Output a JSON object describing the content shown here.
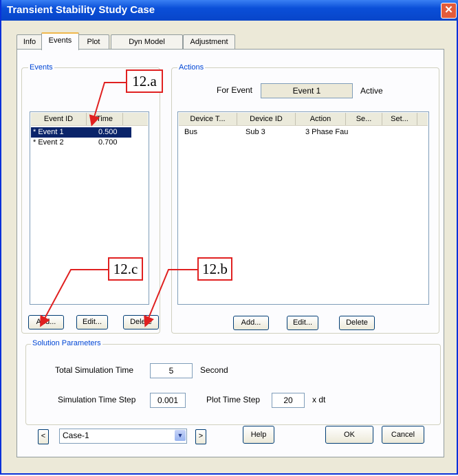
{
  "window": {
    "title": "Transient Stability Study Case",
    "close_glyph": "✕"
  },
  "tabs": [
    "Info",
    "Events",
    "Plot",
    "Dyn Model",
    "Adjustment"
  ],
  "events": {
    "group_label": "Events",
    "columns": [
      "Event ID",
      "Time"
    ],
    "rows": [
      {
        "id": "* Event 1",
        "time": "0.500",
        "selected": true
      },
      {
        "id": "* Event 2",
        "time": "0.700",
        "selected": false
      }
    ],
    "buttons": {
      "add": "Add...",
      "edit": "Edit...",
      "delete": "Delete"
    }
  },
  "actions": {
    "group_label": "Actions",
    "for_event_label": "For Event",
    "for_event_value": "Event 1",
    "status": "Active",
    "columns": [
      "Device T...",
      "Device ID",
      "Action",
      "Se...",
      "Set..."
    ],
    "rows": [
      {
        "device_type": "Bus",
        "device_id": "Sub 3",
        "action": "3 Phase Fau"
      }
    ],
    "buttons": {
      "add": "Add...",
      "edit": "Edit...",
      "delete": "Delete"
    }
  },
  "solution": {
    "group_label": "Solution Parameters",
    "total_sim_time_label": "Total Simulation Time",
    "total_sim_time_value": "5",
    "total_sim_time_unit": "Second",
    "sim_time_step_label": "Simulation Time Step",
    "sim_time_step_value": "0.001",
    "plot_time_step_label": "Plot Time Step",
    "plot_time_step_value": "20",
    "plot_time_step_unit": "x dt"
  },
  "footer": {
    "prev_glyph": "<",
    "next_glyph": ">",
    "case_value": "Case-1",
    "dropdown_glyph": "▼",
    "help": "Help",
    "ok": "OK",
    "cancel": "Cancel"
  },
  "annotations": {
    "a": "12.a",
    "b": "12.b",
    "c": "12.c"
  },
  "colors": {
    "annotation": "#e02020",
    "selection": "#0a246a",
    "titlebar": "#0a4fd8"
  }
}
